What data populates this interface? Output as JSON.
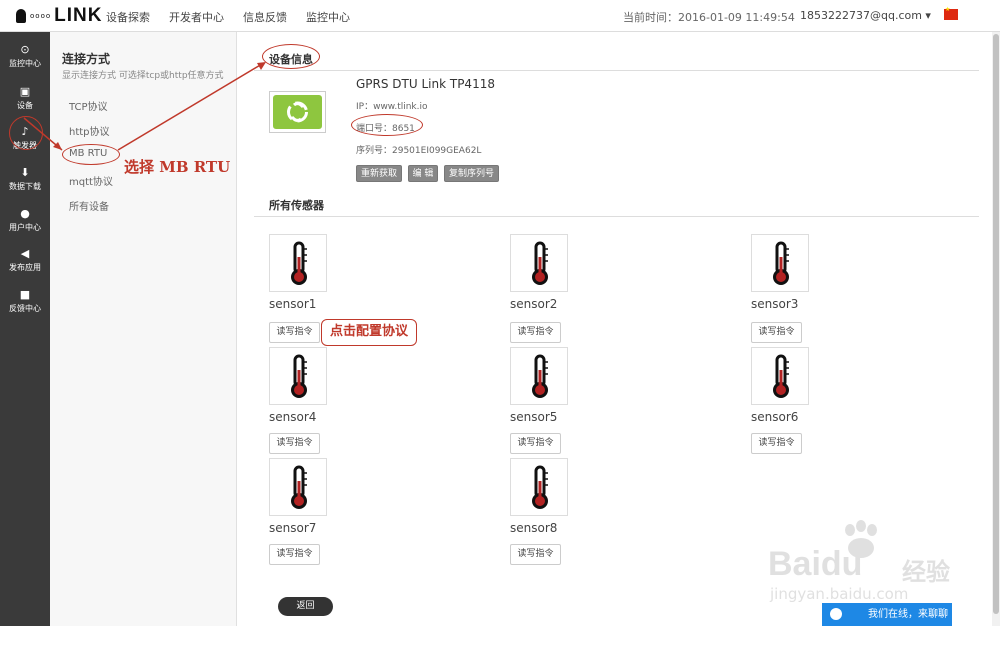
{
  "header": {
    "logo_text": "LINK",
    "logo_dots": "oooo",
    "nav": [
      "设备探索",
      "开发者中心",
      "信息反馈",
      "监控中心"
    ],
    "time_label": "当前时间：2016-01-09 11:49:54",
    "user": "1853222737@qq.com ▾"
  },
  "sidebar": {
    "items": [
      {
        "label": "监控中心",
        "icon": "target-icon",
        "glyph": "⊙"
      },
      {
        "label": "设备",
        "icon": "device-icon",
        "glyph": "▣"
      },
      {
        "label": "触发器",
        "icon": "bell-icon",
        "glyph": "♪"
      },
      {
        "label": "数据下载",
        "icon": "download-icon",
        "glyph": "⬇"
      },
      {
        "label": "用户中心",
        "icon": "user-icon",
        "glyph": "●"
      },
      {
        "label": "发布应用",
        "icon": "send-icon",
        "glyph": "◀"
      },
      {
        "label": "反馈中心",
        "icon": "comment-icon",
        "glyph": "■"
      }
    ]
  },
  "submenu": {
    "title": "连接方式",
    "hint": "显示连接方式 可选择tcp或http任意方式",
    "items": [
      "TCP协议",
      "http协议",
      "MB RTU",
      "mqtt协议",
      "所有设备"
    ]
  },
  "device": {
    "section_title": "设备信息",
    "name": "GPRS DTU Link TP4118",
    "ip": "IP：www.tlink.io",
    "port": "端口号：8651",
    "serial": "序列号：29501EI099GEA62L",
    "buttons": [
      "重新获取",
      "编 辑",
      "复制序列号"
    ]
  },
  "sensors": {
    "section_title": "所有传感器",
    "read_label": "读写指令",
    "items": [
      "sensor1",
      "sensor2",
      "sensor3",
      "sensor4",
      "sensor5",
      "sensor6",
      "sensor7",
      "sensor8"
    ]
  },
  "back_label": "返回",
  "annotations": {
    "select_mbrtu": "选择 MB RTU",
    "config_protocol": "点击配置协议"
  },
  "chat": {
    "label": "我们在线，来聊聊吧"
  },
  "watermark": {
    "brand": "Baidu",
    "cn": "经验",
    "url": "jingyan.baidu.com"
  },
  "colors": {
    "accent_red": "#c0392b",
    "sidebar": "#3a3a3a",
    "device_icon": "#8ec63f",
    "chat": "#1e88e5",
    "thermometer": "#b22222"
  }
}
